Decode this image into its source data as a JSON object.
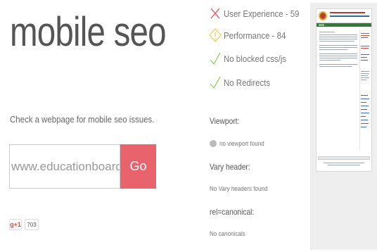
{
  "brand": {
    "title": "mobile seo"
  },
  "search": {
    "intro": "Check a webpage for mobile seo issues.",
    "url_value": "www.educationboard.gov.bd",
    "go_label": "Go"
  },
  "social": {
    "gplus_label": "g+1",
    "gplus_count": "703"
  },
  "checks": [
    {
      "label": "User Experience - 59",
      "icon": "x-icon",
      "color": "#e8636c"
    },
    {
      "label": "Performance - 84",
      "icon": "warning-icon",
      "color": "#f2c94c"
    },
    {
      "label": "No blocked css/js",
      "icon": "check-icon",
      "color": "#9ccc65"
    },
    {
      "label": "No Redirects",
      "icon": "check-icon",
      "color": "#9ccc65"
    }
  ],
  "details": {
    "viewport_title": "Viewport:",
    "viewport_text": "no viewport found",
    "vary_title": "Vary header:",
    "vary_text": "No Vary headers found",
    "canonical_title": "rel=canonical:",
    "canonical_text": "No canonicals"
  }
}
